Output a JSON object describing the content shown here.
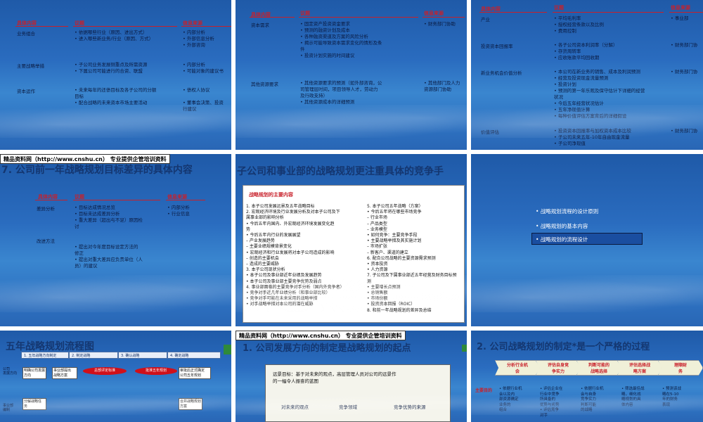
{
  "s1": {
    "h": [
      "具体内容",
      "议题",
      "信息来源"
    ],
    "rows": [
      {
        "label": "业务组合",
        "c1": "•  依据哪些行业（原因、进出方式）\n•  进入哪些新业务/行业（原因、方式）",
        "c2": "•  内部分析\n•  外部信息分析\n•  外部咨询"
      },
      {
        "label": "主要战略举措",
        "c1": "•  子公司业务发展侧重点及所需资源\n•  下属公司可能进行的合资、联盟",
        "c2": "•  内部分析\n•  可能对象的建议书"
      },
      {
        "label": "资本运作",
        "c1": "•  未来每年的还债目标及各子公司的分额\n   目标\n•  配合战略的未来资本市场主要活动",
        "c2": "•  债权人协议\n\n•  董事会决策、投资\n   行建议"
      }
    ]
  },
  "s2": {
    "h": [
      "具体内容",
      "议题",
      "信息来源"
    ],
    "rows": [
      {
        "label": "资本需求",
        "c1": "•  固定资产投资资金要求\n•  预测的融资计划及成本\n•  各种融资渠道及方案的风险分析\n•  揭示可能导致资本需求变化的情形及条\n   件\n•  投资计划实施的时间建议",
        "c2": "•  财务部门协助"
      },
      {
        "label": "其他资源要求",
        "c1": "•  其他资源要求的预测（如外部咨询，公\n   司管理层时间，项目领导人才，劳动力\n   及行政支持）\n•  其他资源成本的详细预测",
        "c2": "•  其他部门及人力\n   资源部门协助"
      }
    ]
  },
  "s3": {
    "h": [
      "具体内容",
      "议题",
      "信息来源"
    ],
    "rows": [
      {
        "label": "产业",
        "c1": "•  平均毛利率\n•  授权经营条款以及比例\n•  费用控制",
        "c2": "•  事业部"
      },
      {
        "label": "投资资本回报率",
        "c1": "•  各子公司资本利润率（分解）\n•  存货周转率\n•  应收账款平均回收期",
        "c2": "•  财务部门协"
      },
      {
        "label": "新业务机会价值分析",
        "c1": "•  本公司在新业务的销售、成本及利润预测\n•  经营及投资现金流量预测\n•  投资计划\n•  预测的第一年乐观及保守估计下详细的经营\n   状况\n•  今后五年经营状况估计\n•  五年净现值计算\n•  每种价值评估方案背后的详细假设",
        "c2": "•  财务部门协"
      },
      {
        "label": "价值评估",
        "c1": "•  投资资本回报率与加权资本成本比较\n•  子公司未来五年-10年自由现金流量\n•  子公司净现值",
        "c2": "•  财务部门协"
      }
    ]
  },
  "banner": "精品资料网（http://www.cnshu.cn） 专业提供企管培训资料",
  "s4": {
    "title": "7. 公司前一年战略规划目标差异的具体内容",
    "h": [
      "具体内容",
      "议题",
      "信息来源"
    ],
    "rows": [
      {
        "label": "差异分析",
        "c1": "•  目标达成情况总览\n•  目标未达成差异分析\n•  重大差异（超出与不足）原因检\n   讨",
        "c2": "•  内部分析\n•  行业信息"
      },
      {
        "label": "改进方法",
        "c1": "•  提出对今年度目标设定方法的\n   修正\n•  提出对重大差异应负责单位（人\n   员）的建议",
        "c2": ""
      }
    ]
  },
  "s5": {
    "title": "子公司和事业部的战略规划更注重具体的竞争手",
    "ptitle": "战略规划的主要内容",
    "left": "1.  本子公司发展远景及五年战略目标\n2.  宏观经济环境及行业发展分析及对本子公司及下\n    属事业部的影响分析\n    •  今后五年内国内、外宏观经济环境发展变化趋\n       势\n    •  今后五年内行业的发展展望\n       –  产业发展趋势\n       –  主要业绩规模背景变化\n    •  宏观经济和行业发展将对本子公司造成的影响\n       –  创造的主要机会\n       –  造成的主要威胁\n3.  本子公司现状分析\n    •  本子公司及事业部近年业绩及发展趋势\n    •  本子公司及事业部主要竞争优势及弱点\n4.  事业部面临的主要竞争对手分析（国内外竞争者）\n    •  竞争对手近几年业绩分析（和事业部比较）\n    •  竞争对手可能在未来采用的战略举措\n    •  对手战略举措对本公司的潜在威胁",
    "right": "5.  本子公司五年战略（方案）\n    •  今后五年将在哪些市场竞争\n       –  行业市场\n       –  产品类型\n       –  业务模型\n    •  如何竞争：主要竞争手段\n    •  主要战略举措及其实施计划\n       –  市场扩张\n       –  新客户、渠道的建立\n6.  配合公司战略的主要资源需求预测\n    •  资本投资\n    •  人力资源\n7.  子公司及下属事业部近五年经营及财务目标预\n    测\n    •  主要增长点预测\n    •  总销售额\n    •  市场份额\n    •  投资资本回报（ROIC）\n8.  和前一年战略规划的差异及总结"
  },
  "s6": {
    "items": [
      "战略规划流程的设计原则",
      "战略规划的基本内容",
      "战略规划的流程设计"
    ]
  },
  "s7": {
    "title": "五年战略规划流程图",
    "steps": [
      "1.  五年战略方向制定",
      "2.  制定战略",
      "3.  确认战略",
      "4.  确定战略"
    ],
    "ovals": [
      "总部评定标准",
      "批准五年规划"
    ],
    "boxes": [
      "明确公司发展\n方向",
      "事业部提出\n战略方案",
      "分解战略任\n务",
      "合并战略规划\n方案",
      "审批后正式确定\n公司五年规划"
    ],
    "rowlabels": [
      "公司\n发展方向",
      "事业部\n编制"
    ]
  },
  "s8": {
    "title": "1. 公司发展方向的制定是战略规划的起点",
    "scroll": "远景目标：基于对未来的观点，高层管理人员对公司的远景作\n的一幅令人振奋的蓝图",
    "cols": [
      "对未来的观点",
      "竞争领域",
      "竞争优势的来源"
    ]
  },
  "s9": {
    "title": "2. 公司战略规划的制定*是一个严格的过程",
    "chevrons": [
      "分析行业机\n会",
      "评估自身竞\n争实力",
      "判断可能的\n战略选择",
      "评估选择战\n略方案",
      "理顺财\n务"
    ],
    "rowlabel": "主要目的",
    "cols": [
      "•  依据行业机\n   会以及内\n   部资源确定\n   业务的\n   组合",
      "•  评估企业在\n   行业中竞争\n   所具备的\n   优势与劣势\n•  评估竞争\n   对手",
      "•  依据行业机\n   会与自身\n   竞争实力\n   判断可能\n   的战略",
      "•  筛选最佳战\n   略，细化战\n   略规划的具\n   体内容",
      "•  预测该战\n   略在5-10\n   年的财务\n   表现"
    ]
  }
}
